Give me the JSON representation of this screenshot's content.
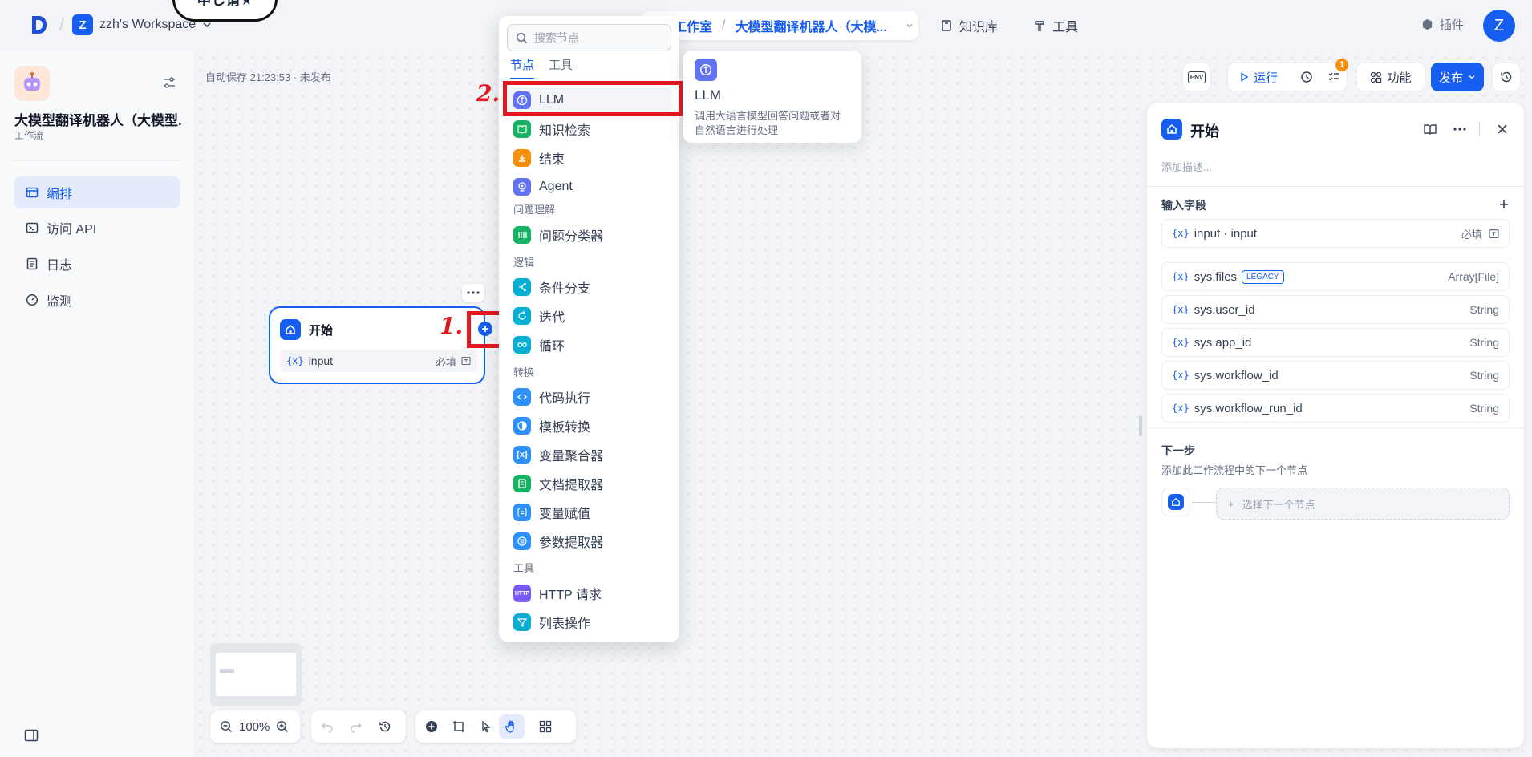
{
  "stamp_text": "申し请★",
  "workspace": {
    "badge": "Z",
    "name": "zzh's Workspace"
  },
  "breadcrumb": {
    "studio": "工作室",
    "app": "大模型翻译机器人（大模..."
  },
  "nav": {
    "knowledge": "知识库",
    "tools": "工具",
    "plugins": "插件"
  },
  "user": {
    "avatar": "Z"
  },
  "app": {
    "name": "大模型翻译机器人（大模型...",
    "type": "工作流"
  },
  "sidebar": {
    "items": [
      {
        "label": "编排",
        "icon": "layout-icon"
      },
      {
        "label": "访问 API",
        "icon": "terminal-icon"
      },
      {
        "label": "日志",
        "icon": "log-icon"
      },
      {
        "label": "监测",
        "icon": "monitor-icon"
      }
    ]
  },
  "autosave": "自动保存 21:23:53 · 未发布",
  "start_node": {
    "title": "开始",
    "field": "input",
    "required": "必填"
  },
  "annotations": {
    "step1": "1.",
    "step2": "2."
  },
  "picker": {
    "search_placeholder": "搜索节点",
    "tabs": [
      "节点",
      "工具"
    ],
    "items": {
      "llm": "LLM",
      "knowledge": "知识检索",
      "end": "结束",
      "agent": "Agent",
      "cat_understanding": "问题理解",
      "classifier": "问题分类器",
      "cat_logic": "逻辑",
      "ifelse": "条件分支",
      "iteration": "迭代",
      "loop": "循环",
      "cat_transform": "转换",
      "code": "代码执行",
      "template": "模板转换",
      "aggregator": "变量聚合器",
      "doc_extractor": "文档提取器",
      "assigner": "变量赋值",
      "param_extractor": "参数提取器",
      "cat_tools": "工具",
      "http": "HTTP 请求",
      "http_icon": "HTTP",
      "list_op": "列表操作"
    }
  },
  "tooltip": {
    "title": "LLM",
    "desc1": "调用大语言模型回答问题或者对",
    "desc2": "自然语言进行处理"
  },
  "toolbar": {
    "env": "ENV",
    "run": "运行",
    "badge": "1",
    "features": "功能",
    "publish": "发布"
  },
  "panel": {
    "title": "开始",
    "desc_placeholder": "添加描述...",
    "input_title": "输入字段",
    "input_row": {
      "name": "input · input",
      "required": "必填"
    },
    "sys_rows": [
      {
        "name": "sys.files",
        "type": "Array[File]",
        "tag": "LEGACY"
      },
      {
        "name": "sys.user_id",
        "type": "String"
      },
      {
        "name": "sys.app_id",
        "type": "String"
      },
      {
        "name": "sys.workflow_id",
        "type": "String"
      },
      {
        "name": "sys.workflow_run_id",
        "type": "String"
      }
    ],
    "next_title": "下一步",
    "next_desc": "添加此工作流程中的下一个节点",
    "next_select": "选择下一个节点"
  },
  "zoom": "100%",
  "var_glyph": "{x}"
}
